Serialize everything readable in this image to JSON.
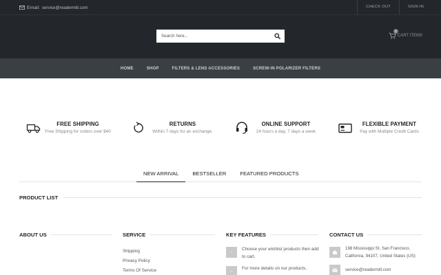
{
  "topbar": {
    "email_label": "Email:",
    "email": "service@readermill.com",
    "checkout": "CHECK OUT",
    "signin": "SIGN IN"
  },
  "header": {
    "search_placeholder": "Search here...",
    "cart_label": "CART ITEMS",
    "cart_count": "0"
  },
  "nav": {
    "items": [
      "HOME",
      "SHOP",
      "FILTERS & LENS ACCESSORIES",
      "SCREW-IN POLARIZER FILTERS"
    ]
  },
  "features": [
    {
      "icon": "truck-icon",
      "title": "FREE SHIPPING",
      "desc": "Free Shipping for orders over $40"
    },
    {
      "icon": "returns-icon",
      "title": "RETURNS",
      "desc": "Within 7 days for an exchange."
    },
    {
      "icon": "headset-icon",
      "title": "ONLINE SUPPORT",
      "desc": "24 hours a day, 7 days a week"
    },
    {
      "icon": "card-icon",
      "title": "FLEXIBLE PAYMENT",
      "desc": "Pay with Multiple Credit Cards"
    }
  ],
  "tabs": [
    "NEW ARRIVAL",
    "BESTSELLER",
    "FEATURED PRODUCTS"
  ],
  "product_list": {
    "title": "PRODUCT LIST"
  },
  "footer": {
    "about": {
      "title": "ABOUT US"
    },
    "service": {
      "title": "SERVICE",
      "links": [
        "Shipping",
        "Privacy Policy",
        "Terms Of Service"
      ]
    },
    "key_features": {
      "title": "KEY FEATURES",
      "items": [
        "Choose your wishlist products then add to cart.",
        "For more details on our products,"
      ]
    },
    "contact": {
      "title": "CONTACT US",
      "address": "198 Mississippi St, San Francisco, California, 94107, United States (US)",
      "email": "service@readermill.com"
    }
  },
  "colors": {
    "header_bg": "#23272b",
    "nav_bg": "#3a3f44",
    "accent_icon_bg": "#c9c9c9"
  }
}
